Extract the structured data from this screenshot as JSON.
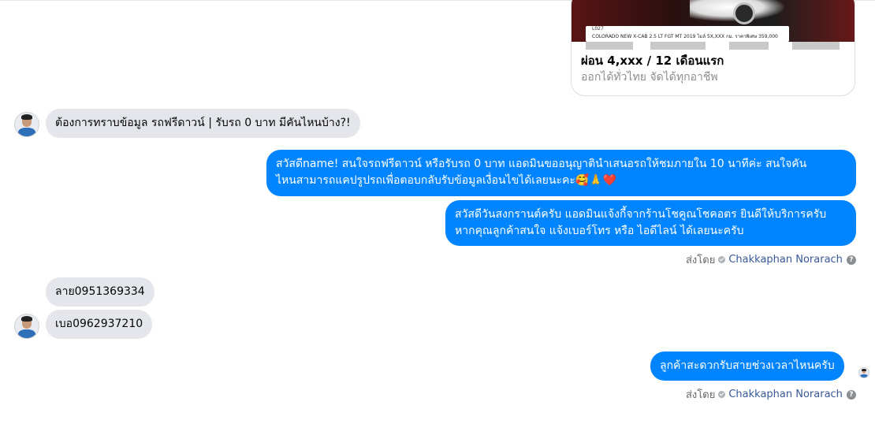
{
  "ad_card": {
    "image_code": "L027",
    "image_model": "COLORADO NEW X-CAB 2.5 LT FGT MT 2019 ไมล์ 5X,XXX กม. ราคาพิเศษ 359,000",
    "title": "ผ่อน 4,xxx / 12 เดือนแรก",
    "subtitle": "ออกได้ทั่วไทย จัดได้ทุกอาชีพ"
  },
  "messages": {
    "customer_1": "ต้องการทราบข้อมูล รถฟรีดาวน์ | รับรถ 0 บาท มีคันไหนบ้าง?!",
    "page_1": {
      "line1": "สวัสดีname! สนใจรถฟรีดาวน์ หรือรับรถ 0 บาท แอดมินขออนุญาตินำเสนอรถให้ชมภายใน 10 นาทีค่ะ สนใจคัน",
      "line2": "ไหนสามารถแคปรูปรถเพื่อตอบกลับรับข้อมูลเงื่อนไขได้เลยนะคะ🥰🙏❤️"
    },
    "page_2": {
      "line1": "สวัสดีวันสงกรานต์ครับ แอดมินแจ้งกี้จากร้านโชคูณโชคอตร ยินดีให้บริการครับ",
      "line2": "หากคุณลูกค้าสนใจ แจ้งเบอร์โทร หรือ ไอดีไลน์ ได้เลยนะครับ"
    },
    "customer_2": "ลาย0951369334",
    "customer_3": "เบอ0962937210",
    "page_3": "ลูกค้าสะดวกรับสายช่วงเวลาไหนครับ"
  },
  "sent_by": {
    "label": "ส่งโดย",
    "name": "Chakkaphan Norarach",
    "help": "?"
  }
}
